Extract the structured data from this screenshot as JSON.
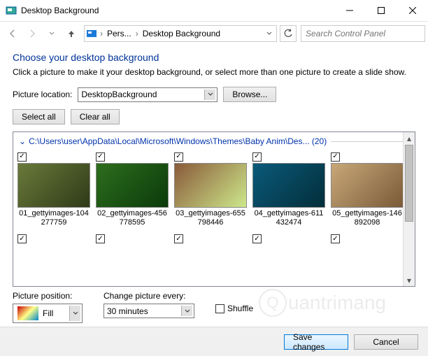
{
  "window": {
    "title": "Desktop Background"
  },
  "nav": {
    "breadcrumb": [
      "Pers...",
      "Desktop Background"
    ],
    "search_placeholder": "Search Control Panel"
  },
  "page": {
    "heading": "Choose your desktop background",
    "subhead": "Click a picture to make it your desktop background, or select more than one picture to create a slide show."
  },
  "location": {
    "label": "Picture location:",
    "value": "DesktopBackground",
    "browse": "Browse..."
  },
  "actions": {
    "select_all": "Select all",
    "clear_all": "Clear all"
  },
  "group": {
    "path": "C:\\Users\\user\\AppData\\Local\\Microsoft\\Windows\\Themes\\Baby Anim\\Des... (20)"
  },
  "thumbs": [
    {
      "name": "01_gettyimages-104277759",
      "checked": true,
      "color1": "#6a7a3a",
      "color2": "#2e3a18"
    },
    {
      "name": "02_gettyimages-456778595",
      "checked": true,
      "color1": "#2e6e1e",
      "color2": "#0a3a0a"
    },
    {
      "name": "03_gettyimages-655798446",
      "checked": true,
      "color1": "#8a5a3a",
      "color2": "#cde88a"
    },
    {
      "name": "04_gettyimages-611432474",
      "checked": true,
      "color1": "#0a5a7a",
      "color2": "#032e3a"
    },
    {
      "name": "05_gettyimages-146892098",
      "checked": true,
      "color1": "#c8a878",
      "color2": "#7a5a38"
    }
  ],
  "row2_checks": [
    true,
    true,
    true,
    true,
    true
  ],
  "position": {
    "label": "Picture position:",
    "value": "Fill"
  },
  "change": {
    "label": "Change picture every:",
    "value": "30 minutes"
  },
  "shuffle": {
    "label": "Shuffle",
    "checked": false
  },
  "footer": {
    "save": "Save changes",
    "cancel": "Cancel"
  }
}
